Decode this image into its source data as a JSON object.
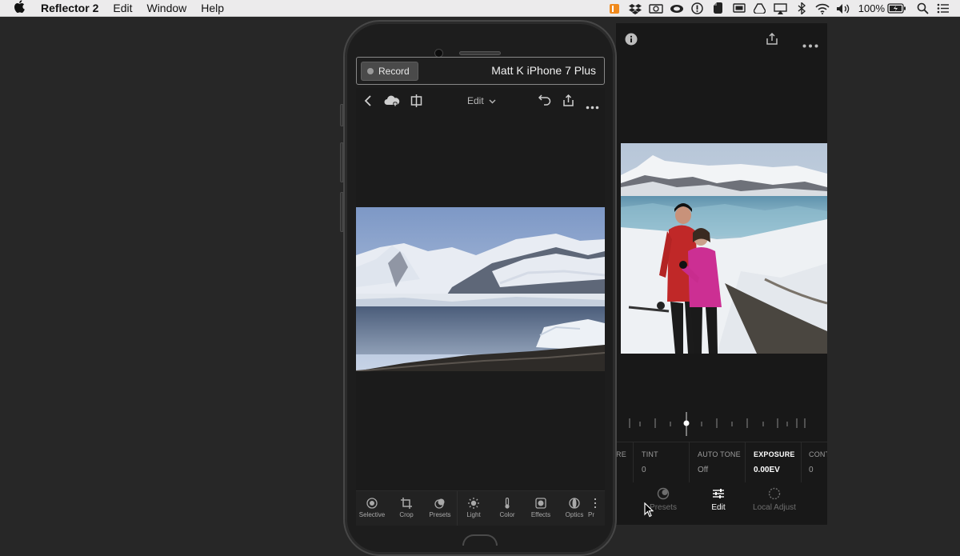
{
  "menubar": {
    "app_name": "Reflector 2",
    "menus": [
      "Edit",
      "Window",
      "Help"
    ],
    "battery": "100%"
  },
  "recorder": {
    "record_label": "Record",
    "device_name": "Matt K iPhone 7 Plus"
  },
  "phone_app": {
    "edit_label": "Edit",
    "tools": [
      {
        "label": "Selective",
        "icon": "selective-icon"
      },
      {
        "label": "Crop",
        "icon": "crop-icon"
      },
      {
        "label": "Presets",
        "icon": "presets-icon"
      },
      {
        "label": "Light",
        "icon": "light-icon"
      },
      {
        "label": "Color",
        "icon": "color-thermometer-icon"
      },
      {
        "label": "Effects",
        "icon": "effects-icon"
      },
      {
        "label": "Optics",
        "icon": "optics-icon"
      },
      {
        "label": "Pr",
        "icon": "profile-icon"
      }
    ]
  },
  "ipad_app": {
    "params": [
      {
        "label": "RE",
        "value": ""
      },
      {
        "label": "TINT",
        "value": "0"
      },
      {
        "label": "AUTO TONE",
        "value": "Off"
      },
      {
        "label": "EXPOSURE",
        "value": "0.00EV"
      },
      {
        "label": "CONT",
        "value": "0"
      }
    ],
    "tabs": [
      {
        "label": "Presets",
        "icon": "presets-icon"
      },
      {
        "label": "Edit",
        "icon": "sliders-icon"
      },
      {
        "label": "Local Adjust",
        "icon": "local-adjust-icon"
      }
    ]
  },
  "colors": {
    "menubar_bg": "#ecebec",
    "desktop_bg": "#272727",
    "app_bg": "#1b1b1b",
    "active_text": "#ffffff",
    "inactive_text": "#9c9c9c"
  }
}
